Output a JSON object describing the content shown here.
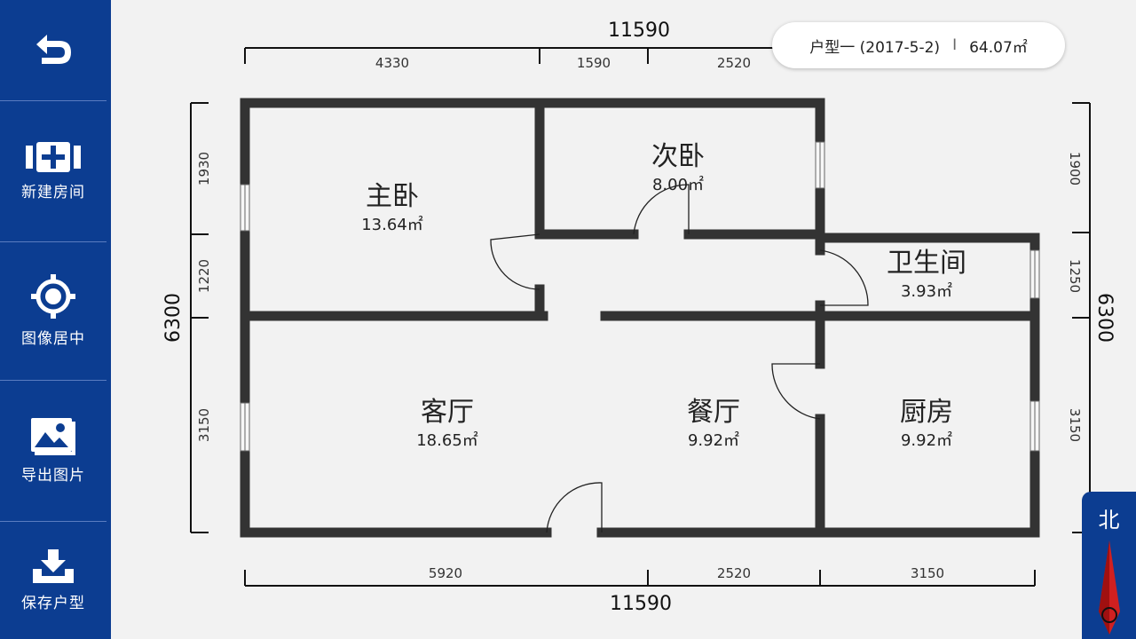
{
  "sidebar": {
    "items": [
      {
        "icon": "back-icon",
        "label": ""
      },
      {
        "icon": "add-room-icon",
        "label": "新建房间"
      },
      {
        "icon": "center-icon",
        "label": "图像居中"
      },
      {
        "icon": "image-icon",
        "label": "导出图片"
      },
      {
        "icon": "download-icon",
        "label": "保存户型"
      }
    ]
  },
  "info": {
    "name": "户型一 (2017-5-2)",
    "separator": "I",
    "area": "64.07㎡"
  },
  "compass": {
    "north": "北"
  },
  "dimensions": {
    "top_total": "11590",
    "top_segments": [
      "4330",
      "1590",
      "2520"
    ],
    "bottom_total": "11590",
    "bottom_segments": [
      "5920",
      "2520",
      "3150"
    ],
    "left_total": "6300",
    "left_segments": [
      "1930",
      "1220",
      "3150"
    ],
    "right_total": "6300",
    "right_segments": [
      "1900",
      "1250",
      "3150"
    ]
  },
  "rooms": [
    {
      "name": "主卧",
      "area": "13.64㎡"
    },
    {
      "name": "次卧",
      "area": "8.00㎡"
    },
    {
      "name": "卫生间",
      "area": "3.93㎡"
    },
    {
      "name": "客厅",
      "area": "18.65㎡"
    },
    {
      "name": "餐厅",
      "area": "9.92㎡"
    },
    {
      "name": "厨房",
      "area": "9.92㎡"
    }
  ],
  "colors": {
    "sidebar": "#0c3d91",
    "wall": "#333333",
    "background": "#f2f2f2",
    "compass_needle": "#d02020"
  }
}
